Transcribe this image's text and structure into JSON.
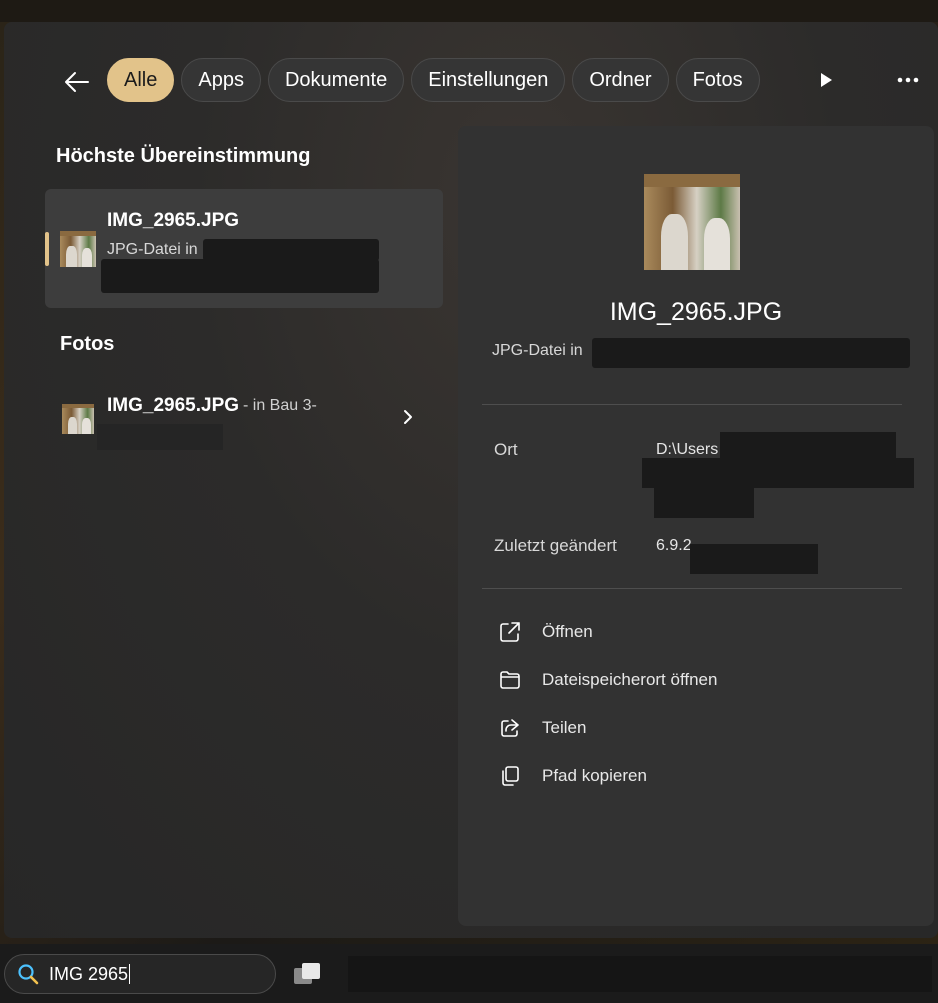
{
  "filters": {
    "back_icon": "arrow-left-icon",
    "chips": [
      {
        "label": "Alle",
        "active": true
      },
      {
        "label": "Apps",
        "active": false
      },
      {
        "label": "Dokumente",
        "active": false
      },
      {
        "label": "Einstellungen",
        "active": false
      },
      {
        "label": "Ordner",
        "active": false
      },
      {
        "label": "Fotos",
        "active": false
      }
    ],
    "more_chips_icon": "play-icon",
    "more_options_icon": "ellipsis-icon"
  },
  "best_match": {
    "heading": "Höchste Übereinstimmung",
    "name": "IMG_2965.JPG",
    "type": "JPG-Datei in"
  },
  "photos": {
    "heading": "Fotos",
    "name": "IMG_2965.JPG",
    "location": " - in Bau 3-"
  },
  "details": {
    "name": "IMG_2965.JPG",
    "type": "JPG-Datei in",
    "location_label": "Ort",
    "location_value": "D:\\Users",
    "modified_label": "Zuletzt geändert",
    "modified_value": "6.9.2",
    "actions": [
      {
        "label": "Öffnen",
        "icon": "open-external-icon"
      },
      {
        "label": "Dateispeicherort öffnen",
        "icon": "folder-icon"
      },
      {
        "label": "Teilen",
        "icon": "share-icon"
      },
      {
        "label": "Pfad kopieren",
        "icon": "copy-icon"
      }
    ]
  },
  "taskbar": {
    "search_query": "IMG 2965",
    "search_icon": "search-icon"
  },
  "colors": {
    "accent": "#e2c38a",
    "panel": "#2c2b2a",
    "detail_panel": "#323232"
  }
}
